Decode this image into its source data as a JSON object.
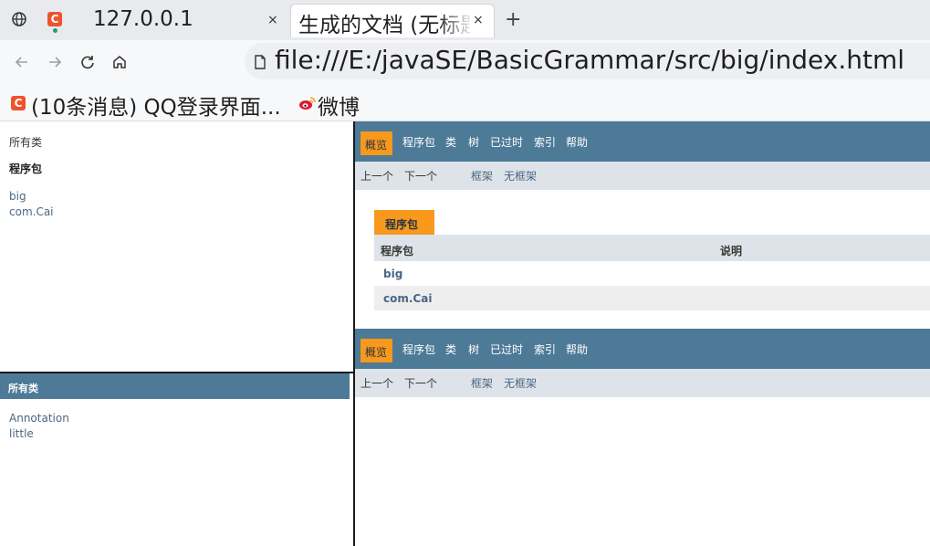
{
  "browser": {
    "tabs": [
      {
        "title": "127.0.0.1",
        "close": "×"
      },
      {
        "title": "生成的文档 (无标题)",
        "close": "×"
      }
    ],
    "new_tab": "+",
    "favicon_letter": "C",
    "url": "file:///E:/javaSE/BasicGrammar/src/big/index.html",
    "bookmarks": [
      {
        "label": "(10条消息) QQ登录界面..."
      },
      {
        "label": "微博"
      }
    ]
  },
  "left_top": {
    "all_classes": "所有类",
    "packages_heading": "程序包",
    "packages": [
      "big",
      "com.Cai"
    ]
  },
  "left_bottom": {
    "heading": "所有类",
    "classes": [
      "Annotation",
      "little"
    ]
  },
  "navbar": {
    "items": [
      "概览",
      "程序包",
      "类",
      "树",
      "已过时",
      "索引",
      "帮助"
    ],
    "active": "概览"
  },
  "subnav": {
    "prev": "上一个",
    "next": "下一个",
    "frames": "框架",
    "no_frames": "无框架"
  },
  "package_table": {
    "caption": "程序包",
    "headers": [
      "程序包",
      "说明"
    ],
    "rows": [
      {
        "package": "big",
        "description": ""
      },
      {
        "package": "com.Cai",
        "description": ""
      }
    ]
  },
  "colors": {
    "nav_blue": "#4d7a97",
    "nav_orange": "#f8981d",
    "subnav_gray": "#dee3e9",
    "link": "#4a6782"
  }
}
